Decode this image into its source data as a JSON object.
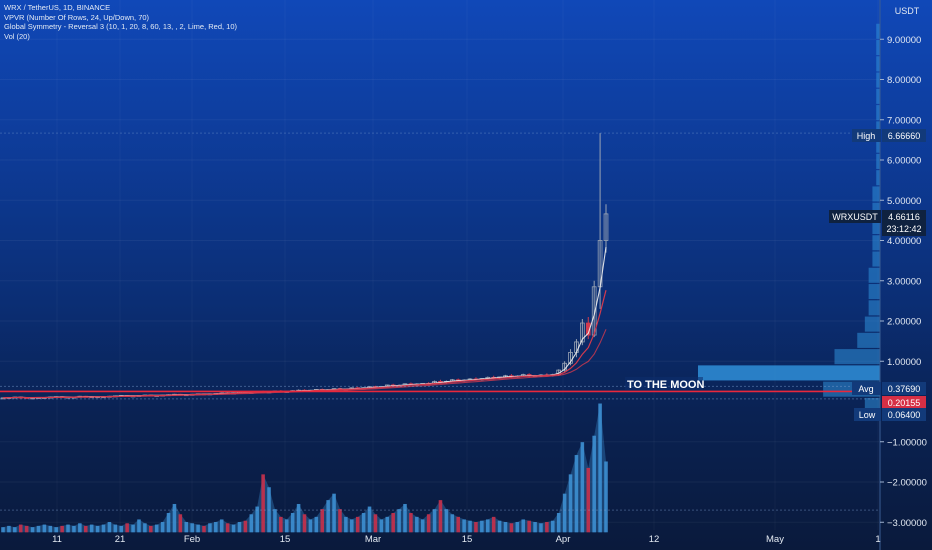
{
  "legend": {
    "symbol_line": "WRX / TetherUS, 1D, BINANCE",
    "vpvr_line": "VPVR (Number Of Rows, 24, Up/Down, 70)",
    "symmetry_line": "Global Symmetry - Reversal 3 (10, 1, 20, 8, 60, 13, , 2, Lime, Red, 10)",
    "vol_line": "Vol (20)"
  },
  "price_axis": {
    "unit": "USDT",
    "tick_labels": [
      "9.00000",
      "8.00000",
      "7.00000",
      "6.00000",
      "5.00000",
      "4.00000",
      "3.00000",
      "2.00000",
      "1.00000",
      "−1.00000",
      "−2.00000",
      "−3.00000"
    ]
  },
  "tags": {
    "high_label": "High",
    "high_value": "6.66660",
    "symbol_label": "WRXUSDT",
    "symbol_value": "4.66116",
    "countdown": "23:12:42",
    "avg_label": "Avg",
    "avg_value": "0.37690",
    "red_value": "0.20155",
    "low_label": "Low",
    "low_value": "0.06400"
  },
  "annotation": "TO THE MOON",
  "colors": {
    "up": "#9aa4b4",
    "down": "#d33a4e",
    "highlight_line": "#e8283c",
    "vol_blue": "#3d8fd1",
    "vol_red": "#c8304a"
  },
  "chart_data": {
    "type": "candlestick",
    "x_tick_labels": [
      "11",
      "21",
      "Feb",
      "15",
      "Mar",
      "15",
      "Apr",
      "12",
      "May",
      "1"
    ],
    "ylim": [
      -3.2,
      10.4
    ],
    "high": 6.6666,
    "low": 0.064,
    "last": 4.66116,
    "avg": 0.3769,
    "red_line": 0.20155,
    "candles": [
      [
        0.09,
        0.1,
        0.08,
        0.09
      ],
      [
        0.09,
        0.11,
        0.08,
        0.1
      ],
      [
        0.1,
        0.12,
        0.09,
        0.11
      ],
      [
        0.11,
        0.12,
        0.09,
        0.1
      ],
      [
        0.1,
        0.11,
        0.08,
        0.09
      ],
      [
        0.09,
        0.1,
        0.08,
        0.09
      ],
      [
        0.09,
        0.11,
        0.08,
        0.1
      ],
      [
        0.1,
        0.11,
        0.09,
        0.1
      ],
      [
        0.1,
        0.12,
        0.09,
        0.11
      ],
      [
        0.11,
        0.13,
        0.1,
        0.12
      ],
      [
        0.12,
        0.13,
        0.1,
        0.11
      ],
      [
        0.11,
        0.12,
        0.1,
        0.11
      ],
      [
        0.11,
        0.12,
        0.1,
        0.11
      ],
      [
        0.11,
        0.14,
        0.1,
        0.13
      ],
      [
        0.13,
        0.14,
        0.11,
        0.12
      ],
      [
        0.12,
        0.13,
        0.11,
        0.12
      ],
      [
        0.12,
        0.13,
        0.11,
        0.12
      ],
      [
        0.12,
        0.13,
        0.11,
        0.12
      ],
      [
        0.12,
        0.14,
        0.11,
        0.13
      ],
      [
        0.13,
        0.15,
        0.12,
        0.14
      ],
      [
        0.14,
        0.16,
        0.13,
        0.15
      ],
      [
        0.15,
        0.16,
        0.13,
        0.14
      ],
      [
        0.14,
        0.15,
        0.13,
        0.14
      ],
      [
        0.14,
        0.16,
        0.13,
        0.15
      ],
      [
        0.15,
        0.17,
        0.14,
        0.16
      ],
      [
        0.16,
        0.17,
        0.14,
        0.15
      ],
      [
        0.15,
        0.16,
        0.14,
        0.15
      ],
      [
        0.15,
        0.17,
        0.14,
        0.16
      ],
      [
        0.16,
        0.18,
        0.15,
        0.17
      ],
      [
        0.17,
        0.19,
        0.15,
        0.18
      ],
      [
        0.18,
        0.19,
        0.16,
        0.17
      ],
      [
        0.17,
        0.18,
        0.16,
        0.17
      ],
      [
        0.17,
        0.19,
        0.16,
        0.18
      ],
      [
        0.18,
        0.2,
        0.17,
        0.19
      ],
      [
        0.19,
        0.2,
        0.17,
        0.18
      ],
      [
        0.18,
        0.2,
        0.17,
        0.19
      ],
      [
        0.19,
        0.21,
        0.18,
        0.2
      ],
      [
        0.2,
        0.22,
        0.18,
        0.21
      ],
      [
        0.21,
        0.23,
        0.19,
        0.2
      ],
      [
        0.2,
        0.22,
        0.19,
        0.21
      ],
      [
        0.21,
        0.25,
        0.2,
        0.24
      ],
      [
        0.24,
        0.26,
        0.21,
        0.22
      ],
      [
        0.22,
        0.24,
        0.21,
        0.23
      ],
      [
        0.23,
        0.26,
        0.22,
        0.25
      ],
      [
        0.25,
        0.27,
        0.22,
        0.23
      ],
      [
        0.23,
        0.25,
        0.21,
        0.24
      ],
      [
        0.24,
        0.27,
        0.23,
        0.26
      ],
      [
        0.26,
        0.28,
        0.23,
        0.24
      ],
      [
        0.24,
        0.26,
        0.22,
        0.25
      ],
      [
        0.25,
        0.28,
        0.24,
        0.27
      ],
      [
        0.27,
        0.3,
        0.25,
        0.28
      ],
      [
        0.28,
        0.3,
        0.25,
        0.26
      ],
      [
        0.26,
        0.29,
        0.25,
        0.28
      ],
      [
        0.28,
        0.31,
        0.26,
        0.3
      ],
      [
        0.3,
        0.32,
        0.27,
        0.28
      ],
      [
        0.28,
        0.3,
        0.26,
        0.29
      ],
      [
        0.29,
        0.33,
        0.28,
        0.32
      ],
      [
        0.32,
        0.34,
        0.29,
        0.3
      ],
      [
        0.3,
        0.32,
        0.28,
        0.31
      ],
      [
        0.31,
        0.35,
        0.3,
        0.34
      ],
      [
        0.34,
        0.36,
        0.3,
        0.32
      ],
      [
        0.32,
        0.35,
        0.31,
        0.34
      ],
      [
        0.34,
        0.38,
        0.33,
        0.37
      ],
      [
        0.37,
        0.39,
        0.33,
        0.35
      ],
      [
        0.35,
        0.38,
        0.34,
        0.37
      ],
      [
        0.37,
        0.42,
        0.36,
        0.41
      ],
      [
        0.41,
        0.44,
        0.37,
        0.39
      ],
      [
        0.39,
        0.42,
        0.37,
        0.4
      ],
      [
        0.4,
        0.45,
        0.39,
        0.44
      ],
      [
        0.44,
        0.47,
        0.4,
        0.42
      ],
      [
        0.42,
        0.45,
        0.4,
        0.43
      ],
      [
        0.43,
        0.46,
        0.41,
        0.45
      ],
      [
        0.45,
        0.48,
        0.42,
        0.44
      ],
      [
        0.44,
        0.52,
        0.43,
        0.5
      ],
      [
        0.5,
        0.54,
        0.45,
        0.47
      ],
      [
        0.47,
        0.52,
        0.45,
        0.5
      ],
      [
        0.5,
        0.56,
        0.48,
        0.54
      ],
      [
        0.54,
        0.57,
        0.49,
        0.51
      ],
      [
        0.51,
        0.55,
        0.49,
        0.53
      ],
      [
        0.53,
        0.58,
        0.51,
        0.56
      ],
      [
        0.56,
        0.6,
        0.52,
        0.54
      ],
      [
        0.54,
        0.58,
        0.52,
        0.57
      ],
      [
        0.57,
        0.62,
        0.55,
        0.6
      ],
      [
        0.6,
        0.64,
        0.55,
        0.58
      ],
      [
        0.58,
        0.62,
        0.56,
        0.61
      ],
      [
        0.61,
        0.66,
        0.59,
        0.64
      ],
      [
        0.64,
        0.68,
        0.58,
        0.61
      ],
      [
        0.61,
        0.65,
        0.59,
        0.63
      ],
      [
        0.63,
        0.69,
        0.61,
        0.67
      ],
      [
        0.67,
        0.7,
        0.6,
        0.63
      ],
      [
        0.63,
        0.66,
        0.6,
        0.64
      ],
      [
        0.64,
        0.68,
        0.61,
        0.66
      ],
      [
        0.66,
        0.7,
        0.62,
        0.65
      ],
      [
        0.65,
        0.69,
        0.62,
        0.67
      ],
      [
        0.67,
        0.8,
        0.64,
        0.78
      ],
      [
        0.78,
        1.0,
        0.74,
        0.95
      ],
      [
        0.95,
        1.3,
        0.9,
        1.22
      ],
      [
        1.22,
        1.55,
        1.1,
        1.48
      ],
      [
        1.48,
        2.05,
        1.4,
        1.95
      ],
      [
        1.95,
        2.1,
        1.55,
        1.65
      ],
      [
        1.65,
        3.0,
        1.6,
        2.85
      ],
      [
        2.85,
        6.6666,
        2.3,
        4.0
      ],
      [
        4.0,
        4.9,
        3.7,
        4.66116
      ]
    ],
    "volume": [
      0.04,
      0.05,
      0.04,
      0.06,
      0.05,
      0.04,
      0.05,
      0.06,
      0.05,
      0.04,
      0.05,
      0.06,
      0.05,
      0.07,
      0.05,
      0.06,
      0.05,
      0.06,
      0.08,
      0.06,
      0.05,
      0.07,
      0.06,
      0.1,
      0.07,
      0.05,
      0.06,
      0.08,
      0.15,
      0.22,
      0.14,
      0.08,
      0.07,
      0.06,
      0.05,
      0.07,
      0.08,
      0.1,
      0.07,
      0.06,
      0.08,
      0.09,
      0.14,
      0.2,
      0.45,
      0.35,
      0.18,
      0.12,
      0.1,
      0.15,
      0.22,
      0.14,
      0.1,
      0.12,
      0.18,
      0.25,
      0.3,
      0.18,
      0.12,
      0.1,
      0.12,
      0.15,
      0.2,
      0.14,
      0.1,
      0.12,
      0.15,
      0.18,
      0.22,
      0.15,
      0.12,
      0.1,
      0.14,
      0.18,
      0.25,
      0.18,
      0.14,
      0.12,
      0.1,
      0.09,
      0.08,
      0.09,
      0.1,
      0.12,
      0.09,
      0.08,
      0.07,
      0.08,
      0.1,
      0.09,
      0.08,
      0.07,
      0.08,
      0.09,
      0.15,
      0.3,
      0.45,
      0.6,
      0.7,
      0.5,
      0.75,
      1.0,
      0.55
    ],
    "volume_profile_rows": [
      0.04,
      0.15,
      0.48,
      0.12,
      0.06,
      0.04,
      0.03,
      0.03,
      0.03,
      0.02,
      0.02,
      0.02,
      0.02,
      0.02,
      0.01,
      0.01,
      0.01,
      0.01,
      0.01,
      0.01,
      0.01,
      0.01,
      0.01,
      0.01
    ]
  }
}
